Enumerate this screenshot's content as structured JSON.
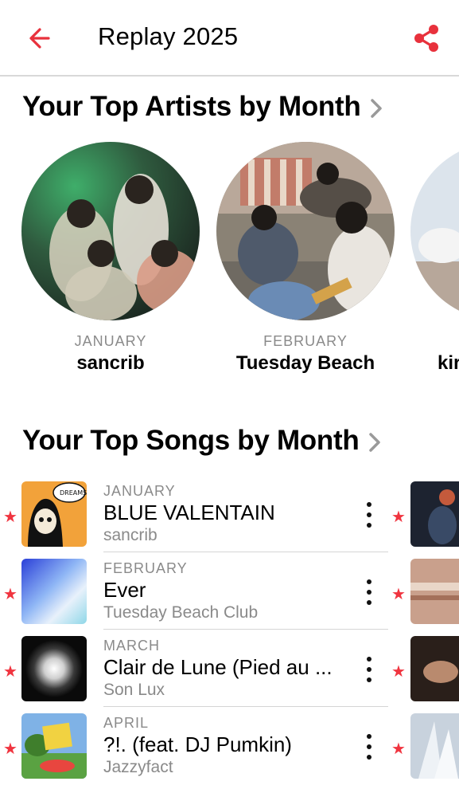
{
  "nav": {
    "title": "Replay 2025",
    "back_icon": "back-arrow-icon",
    "share_icon": "share-icon",
    "accent": "#e8313c"
  },
  "artists_section": {
    "title": "Your Top Artists by Month",
    "items": [
      {
        "month": "JANUARY",
        "name": "sancrib"
      },
      {
        "month": "FEBRUARY",
        "name": "Tuesday Beach"
      },
      {
        "month": "",
        "name": "kir"
      }
    ]
  },
  "songs_section": {
    "title": "Your Top Songs by Month",
    "items": [
      {
        "month": "JANUARY",
        "title": "BLUE VALENTAIN",
        "artist": "sancrib"
      },
      {
        "month": "FEBRUARY",
        "title": "Ever",
        "artist": "Tuesday Beach Club"
      },
      {
        "month": "MARCH",
        "title": "Clair de Lune (Pied au ...",
        "artist": "Son Lux"
      },
      {
        "month": "APRIL",
        "title": "?!. (feat. DJ Pumkin)",
        "artist": "Jazzyfact"
      }
    ]
  },
  "colors": {
    "accent": "#f0343f",
    "secondary_text": "#8a8a8a",
    "divider": "#d5d5d5"
  }
}
